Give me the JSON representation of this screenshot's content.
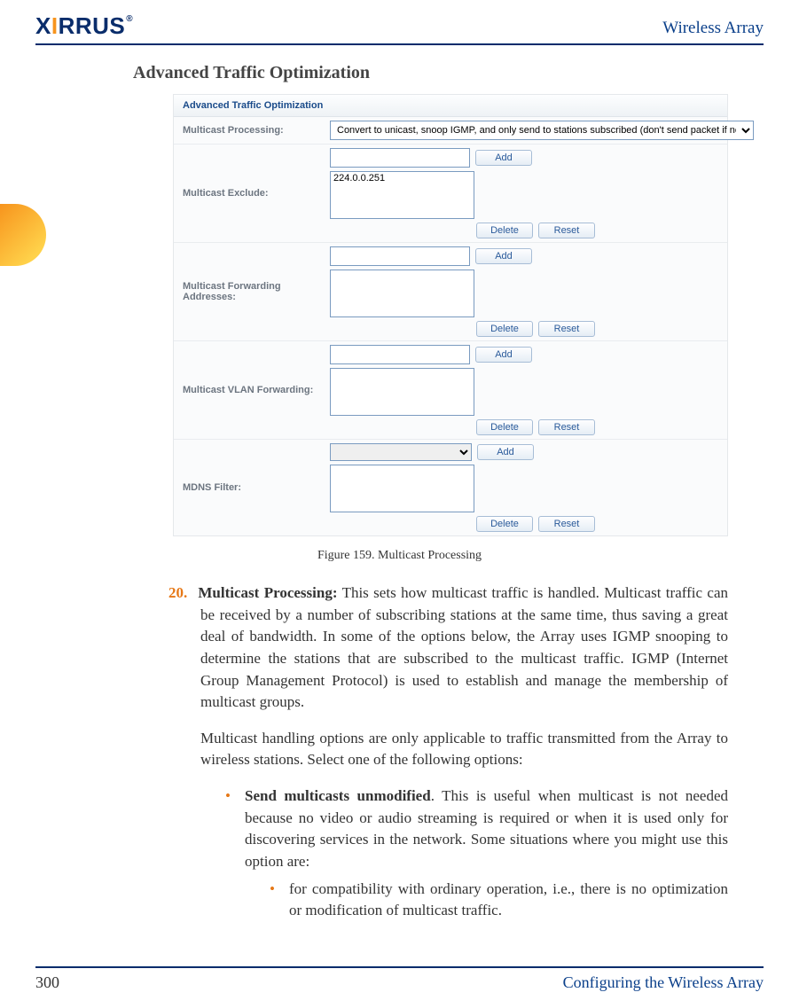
{
  "header": {
    "logo_text_pre": "X",
    "logo_text_dot": "I",
    "logo_text_rest": "RRUS",
    "logo_reg": "®",
    "right": "Wireless Array"
  },
  "section_heading": "Advanced Traffic Optimization",
  "panel": {
    "title": "Advanced Traffic Optimization",
    "rows": {
      "multicast_processing": {
        "label": "Multicast Processing:",
        "selected": "Convert to unicast, snoop IGMP, and only send to stations subscribed (don't send packet if no subscription)"
      },
      "multicast_exclude": {
        "label": "Multicast Exclude:",
        "input_value": "",
        "list_value": "224.0.0.251",
        "add": "Add",
        "delete": "Delete",
        "reset": "Reset"
      },
      "multicast_forwarding": {
        "label": "Multicast Forwarding Addresses:",
        "input_value": "",
        "list_value": "",
        "add": "Add",
        "delete": "Delete",
        "reset": "Reset"
      },
      "multicast_vlan": {
        "label": "Multicast VLAN Forwarding:",
        "input_value": "",
        "list_value": "",
        "add": "Add",
        "delete": "Delete",
        "reset": "Reset"
      },
      "mdns_filter": {
        "label": "MDNS Filter:",
        "select_value": "",
        "list_value": "",
        "add": "Add",
        "delete": "Delete",
        "reset": "Reset"
      }
    }
  },
  "caption": "Figure 159. Multicast Processing",
  "body": {
    "num": "20.",
    "lead_bold": "Multicast Processing:",
    "lead_rest": " This sets how multicast traffic is handled. Multicast traffic can be received by a number of subscribing stations at the same time, thus saving a great deal of bandwidth. In some of the options below, the Array uses IGMP snooping to determine the stations that are subscribed to the multicast traffic. IGMP (Internet Group Management Protocol) is used to establish and manage the membership of multicast groups.",
    "para2": "Multicast handling options are only applicable to traffic transmitted from the Array to wireless stations. Select one of the following options:",
    "bullet1_bold": "Send multicasts unmodified",
    "bullet1_rest": ". This is useful when multicast is not needed because no video or audio streaming is required or when it is used only for discovering services in the network. Some situations where you might use this option are:",
    "sub1": "for compatibility with ordinary operation, i.e., there is no optimization or modification of multicast traffic."
  },
  "footer": {
    "page": "300",
    "section": "Configuring the Wireless Array"
  }
}
